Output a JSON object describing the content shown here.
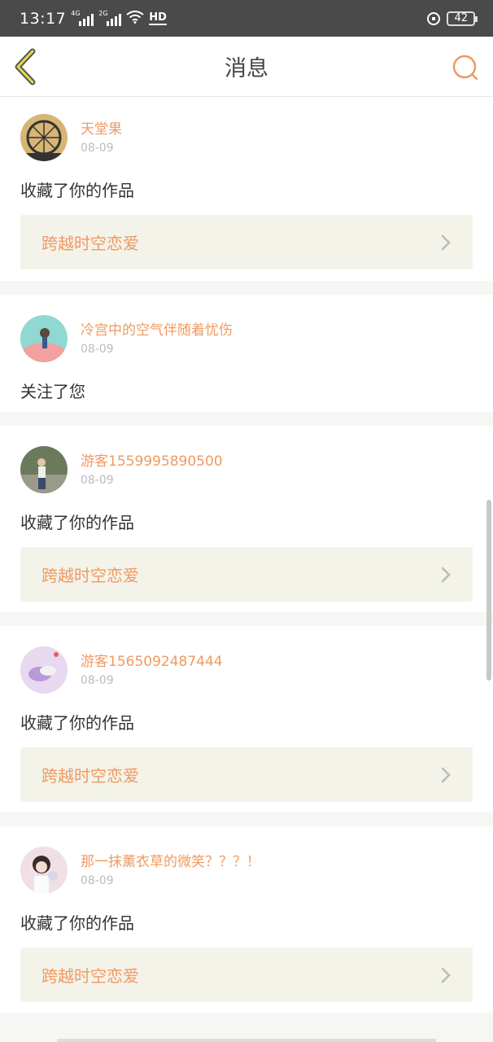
{
  "status": {
    "time": "13:17",
    "network1": "4G",
    "network2": "2G",
    "hd": "HD",
    "battery": "42"
  },
  "header": {
    "title": "消息",
    "back_icon": "chevron-left-icon",
    "search_icon": "search-icon",
    "accent_color": "#ef9a62"
  },
  "messages": [
    {
      "username": "天堂果",
      "date": "08-09",
      "action": "收藏了你的作品",
      "work": "跨越时空恋爱"
    },
    {
      "username": "冷宫中的空气伴随着忧伤",
      "date": "08-09",
      "action": "关注了您"
    },
    {
      "username": "游客1559995890500",
      "date": "08-09",
      "action": "收藏了你的作品",
      "work": "跨越时空恋爱"
    },
    {
      "username": "游客1565092487444",
      "date": "08-09",
      "action": "收藏了你的作品",
      "work": "跨越时空恋爱"
    },
    {
      "username": "那一抹薰衣草的微笑？？？！",
      "date": "08-09",
      "action": "收藏了你的作品",
      "work": "跨越时空恋爱"
    }
  ]
}
